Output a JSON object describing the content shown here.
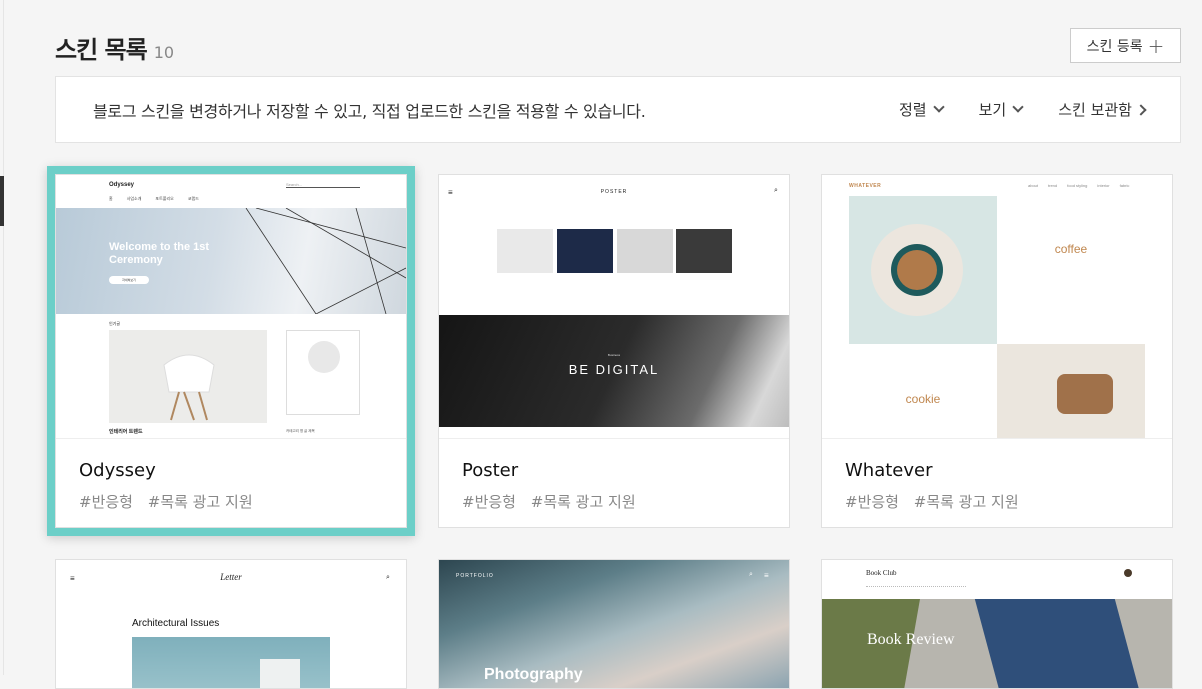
{
  "header": {
    "title": "스킨 목록",
    "count": "10",
    "register_label": "스킨 등록"
  },
  "info_bar": {
    "text": "블로그 스킨을 변경하거나 저장할 수 있고, 직접 업로드한 스킨을 적용할 수 있습니다.",
    "sort_label": "정렬",
    "view_label": "보기",
    "storage_label": "스킨 보관함"
  },
  "skins": [
    {
      "name": "Odyssey",
      "tags": [
        "#반응형",
        "#목록 광고 지원"
      ],
      "selected": true,
      "preview": {
        "logo": "Odyssey",
        "search": "Search...",
        "menu": [
          "홈",
          "사업소개",
          "포트폴리오",
          "코랩드"
        ],
        "hero": "Welcome to the 1st Ceremony",
        "hero_btn": "자세히보기",
        "section": "인기글",
        "post": "인테리어 트렌드",
        "caption": "카테고리 명 글 제목"
      }
    },
    {
      "name": "Poster",
      "tags": [
        "#반응형",
        "#목록 광고 지원"
      ],
      "selected": false,
      "preview": {
        "logo": "POSTER",
        "banner_small": "Business",
        "banner": "BE DIGITAL"
      }
    },
    {
      "name": "Whatever",
      "tags": [
        "#반응형",
        "#목록 광고 지원"
      ],
      "selected": false,
      "preview": {
        "logo": "WHATEVER",
        "menu": [
          "about",
          "trend",
          "food styling",
          "interior",
          "fabric"
        ],
        "item1": "coffee",
        "item2": "cookie"
      }
    },
    {
      "name": "Letter",
      "tags": [],
      "selected": false,
      "preview": {
        "logo": "Letter",
        "post": "Architectural Issues"
      }
    },
    {
      "name": "Portfolio",
      "tags": [],
      "selected": false,
      "preview": {
        "logo": "PORTFOLIO",
        "hero": "Photography"
      }
    },
    {
      "name": "Book Club",
      "tags": [],
      "selected": false,
      "preview": {
        "logo": "Book Club",
        "hero": "Book Review"
      }
    }
  ],
  "colors": {
    "accent": "#6ccfc8",
    "background": "#f5f5f5",
    "tag": "#888888"
  }
}
